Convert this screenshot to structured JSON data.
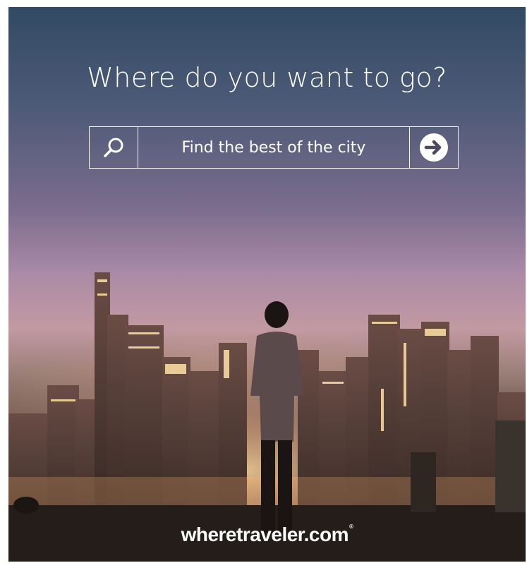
{
  "headline": "Where do you want to go?",
  "search": {
    "placeholder": "Find the best of the city",
    "icon": "search-icon",
    "submit_icon": "arrow-right-circle-icon"
  },
  "brand": {
    "part1": "where",
    "part2": "traveler.com",
    "mark": "®"
  },
  "colors": {
    "text": "#ffffff",
    "sky_top": "#324a63",
    "sky_glow": "#c39aa2",
    "ground": "#241d1a"
  }
}
